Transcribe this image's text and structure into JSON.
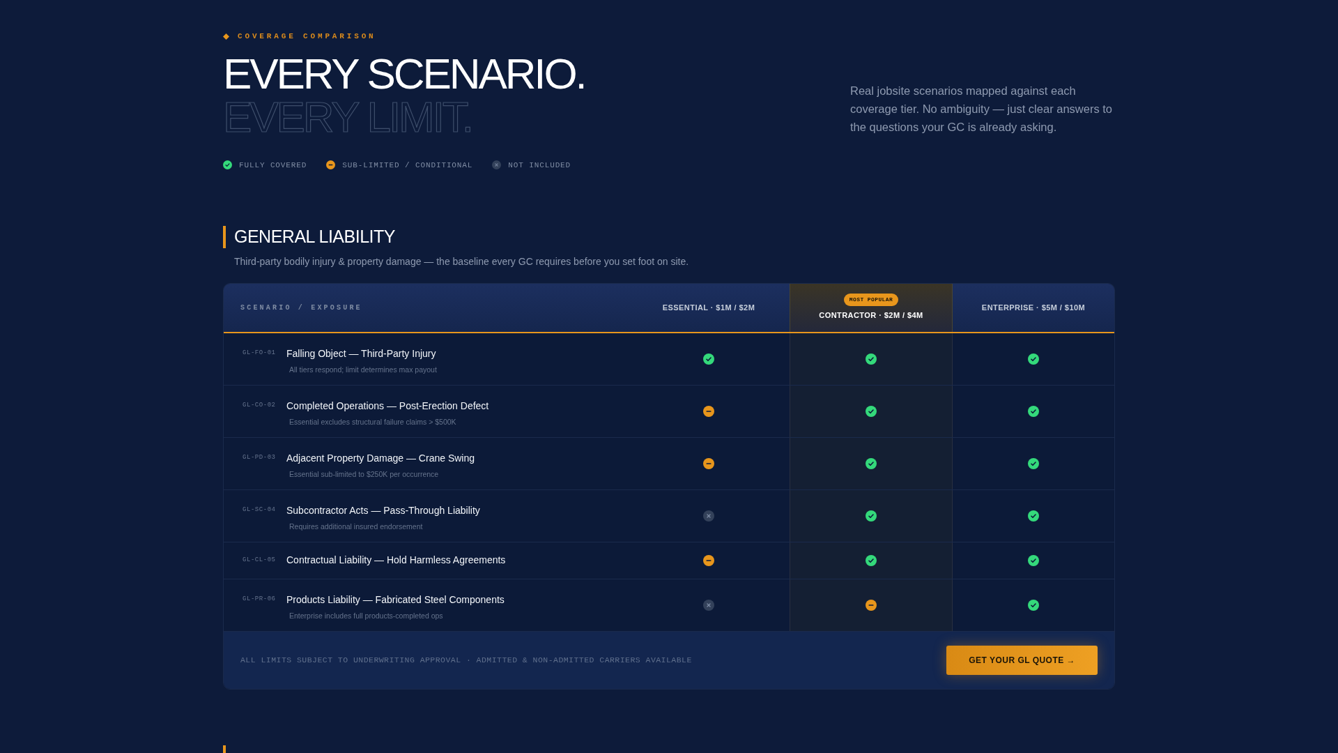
{
  "eyebrow": "COVERAGE COMPARISON",
  "headline": {
    "line_1": "EVERY SCENARIO.",
    "line_2": "EVERY LIMIT."
  },
  "intro": "Real jobsite scenarios mapped against each coverage tier. No ambiguity — just clear answers to the questions your GC is already asking.",
  "legend": [
    {
      "kind": "covered",
      "label": "FULLY COVERED"
    },
    {
      "kind": "limited",
      "label": "SUB-LIMITED / CONDITIONAL"
    },
    {
      "kind": "excluded",
      "label": "NOT INCLUDED"
    }
  ],
  "section": {
    "title": "GENERAL LIABILITY",
    "subtitle": "Third-party bodily injury & property damage — the baseline every GC requires before you set foot on site."
  },
  "table": {
    "first_column": "SCENARIO / EXPOSURE",
    "tiers": [
      {
        "label": "ESSENTIAL · $1M / $2M",
        "highlighted": false
      },
      {
        "label": "CONTRACTOR · $2M / $4M",
        "highlighted": true,
        "badge": "MOST POPULAR"
      },
      {
        "label": "ENTERPRISE · $5M / $10M",
        "highlighted": false
      }
    ],
    "rows": [
      {
        "code": "GL-FO-01",
        "title": "Falling Object — Third-Party Injury",
        "note": "All tiers respond; limit determines max payout",
        "cells": [
          {
            "kind": "covered"
          },
          {
            "kind": "covered"
          },
          {
            "kind": "covered"
          }
        ]
      },
      {
        "code": "GL-CO-02",
        "title": "Completed Operations — Post-Erection Defect",
        "note": "Essential excludes structural failure claims > $500K",
        "cells": [
          {
            "kind": "limited"
          },
          {
            "kind": "covered"
          },
          {
            "kind": "covered"
          }
        ]
      },
      {
        "code": "GL-PD-03",
        "title": "Adjacent Property Damage — Crane Swing",
        "note": "Essential sub-limited to $250K per occurrence",
        "cells": [
          {
            "kind": "limited"
          },
          {
            "kind": "covered"
          },
          {
            "kind": "covered"
          }
        ]
      },
      {
        "code": "GL-SC-04",
        "title": "Subcontractor Acts — Pass-Through Liability",
        "note": "Requires additional insured endorsement",
        "cells": [
          {
            "kind": "excluded"
          },
          {
            "kind": "covered"
          },
          {
            "kind": "covered"
          }
        ]
      },
      {
        "code": "GL-CL-05",
        "title": "Contractual Liability — Hold Harmless Agreements",
        "cells": [
          {
            "kind": "limited"
          },
          {
            "kind": "covered"
          },
          {
            "kind": "covered"
          }
        ]
      },
      {
        "code": "GL-PR-06",
        "title": "Products Liability — Fabricated Steel Components",
        "note": "Enterprise includes full products-completed ops",
        "cells": [
          {
            "kind": "excluded"
          },
          {
            "kind": "limited"
          },
          {
            "kind": "covered"
          }
        ]
      }
    ],
    "footer_note": "ALL LIMITS SUBJECT TO UNDERWRITING APPROVAL · ADMITTED & NON-ADMITTED CARRIERS AVAILABLE",
    "cta": "GET YOUR GL QUOTE →"
  }
}
